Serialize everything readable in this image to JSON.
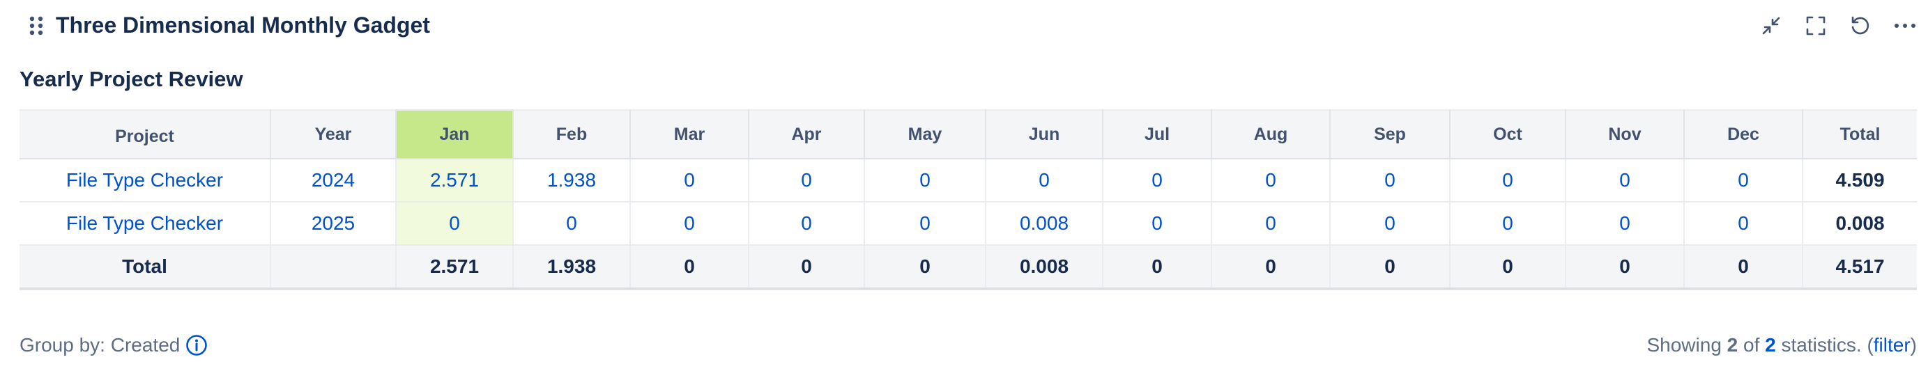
{
  "gadget": {
    "title": "Three Dimensional Monthly Gadget",
    "drag_icon": "drag-handle-icon",
    "toolbar": [
      {
        "name": "minimize-button",
        "icon": "minimize-arrows-icon"
      },
      {
        "name": "fullscreen-button",
        "icon": "expand-corners-icon"
      },
      {
        "name": "refresh-button",
        "icon": "refresh-icon"
      },
      {
        "name": "more-options-button",
        "icon": "more-horizontal-icon"
      }
    ]
  },
  "report": {
    "title": "Yearly Project Review"
  },
  "table": {
    "headers": [
      "Project",
      "Year",
      "Jan",
      "Feb",
      "Mar",
      "Apr",
      "May",
      "Jun",
      "Jul",
      "Aug",
      "Sep",
      "Oct",
      "Nov",
      "Dec",
      "Total"
    ],
    "highlight_column": "Jan",
    "rows": [
      {
        "project": "File Type Checker",
        "year": "2024",
        "months": [
          "2.571",
          "1.938",
          "0",
          "0",
          "0",
          "0",
          "0",
          "0",
          "0",
          "0",
          "0",
          "0"
        ],
        "total": "4.509"
      },
      {
        "project": "File Type Checker",
        "year": "2025",
        "months": [
          "0",
          "0",
          "0",
          "0",
          "0",
          "0.008",
          "0",
          "0",
          "0",
          "0",
          "0",
          "0"
        ],
        "total": "0.008"
      }
    ],
    "total_row": {
      "label": "Total",
      "year": "",
      "months": [
        "2.571",
        "1.938",
        "0",
        "0",
        "0",
        "0.008",
        "0",
        "0",
        "0",
        "0",
        "0",
        "0"
      ],
      "total": "4.517"
    }
  },
  "footer": {
    "group_by": "Group by: Created",
    "info_icon": "info-icon",
    "showing_prefix": "Showing",
    "showing_count": "2",
    "of_text": "of",
    "total_count": "2",
    "stats_text": "statistics. (",
    "filter_label": "filter",
    "close_paren": ")"
  },
  "colors": {
    "highlight_header": "#c6e78a",
    "highlight_cell": "#f1fadd",
    "link": "#0052cc",
    "text": "#172b4d",
    "header_bg": "#f4f5f7"
  }
}
